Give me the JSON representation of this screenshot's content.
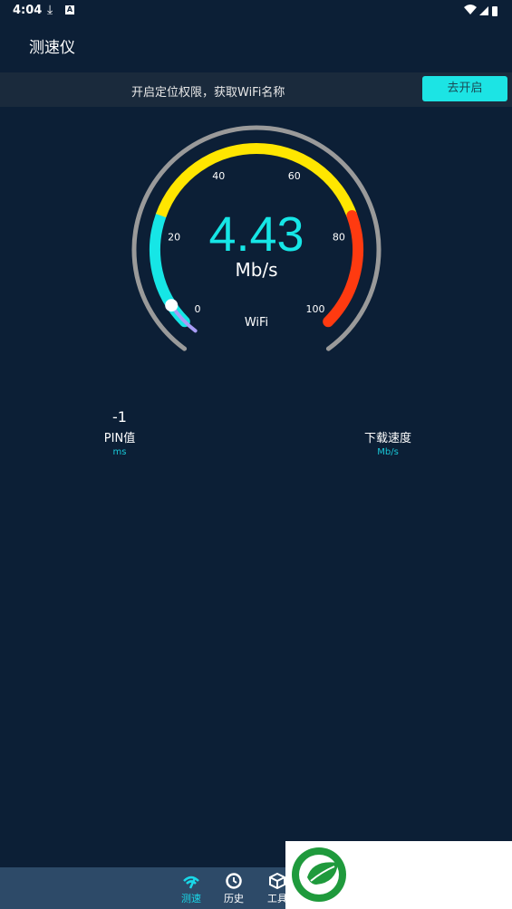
{
  "status": {
    "time": "4:04"
  },
  "app": {
    "title": "测速仪"
  },
  "permission": {
    "text": "开启定位权限，获取WiFi名称",
    "button": "去开启"
  },
  "gauge": {
    "ticks": [
      "0",
      "20",
      "40",
      "60",
      "80",
      "100"
    ],
    "value": "4.43",
    "unit": "Mb/s",
    "network": "WiFi",
    "fraction": 0.044
  },
  "stats": {
    "ping": {
      "value": "-1",
      "label": "PIN值",
      "unit": "ms"
    },
    "download": {
      "value": "",
      "label": "下载速度",
      "unit": "Mb/s"
    }
  },
  "nav": {
    "items": [
      {
        "label": "测速"
      },
      {
        "label": "历史"
      },
      {
        "label": "工具"
      }
    ]
  },
  "colors": {
    "background": "#0c1f36",
    "accent": "#16e6e6",
    "segment_low": "#16e6e6",
    "segment_mid": "#ffe600",
    "segment_high": "#ff3a10",
    "outer_ring": "#9a9a9a"
  }
}
